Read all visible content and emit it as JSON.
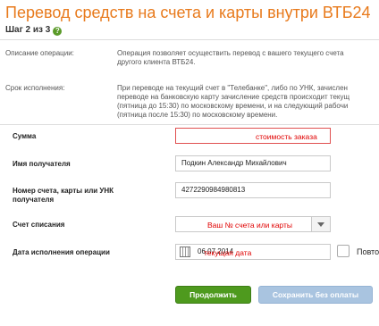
{
  "header": {
    "title": "Перевод средств на счета и карты внутри ВТБ24",
    "step": "Шаг 2 из 3",
    "help_icon": "?"
  },
  "info": {
    "description_label": "Описание операции:",
    "description_text": "Операция позволяет осуществить перевод с вашего текущего счета\nдругого клиента ВТБ24.",
    "timing_label": "Срок исполнения:",
    "timing_text": "При переводе на текущий счет в \"Телебанке\", либо по УНК, зачислен\nпереводе на банковскую карту зачисление средств происходит текущ\n(пятница до 15:30) по московскому времени, и на следующий рабочи\n(пятница после 15:30) по московскому времени."
  },
  "form": {
    "amount_label": "Сумма",
    "amount_value": "",
    "amount_note": "стоимость заказа",
    "recipient_label": "Имя получателя",
    "recipient_value": "Подкин Александр Михайлович",
    "account_label": "Номер счета, карты или УНК\nполучателя",
    "account_value": "4272290984980813",
    "debit_label": "Счет списания",
    "debit_note": "Ваш № счета  или  карты",
    "date_label": "Дата исполнения операции",
    "date_value": "06.07.2014",
    "date_note": "текущая дата",
    "repeat_label": "Повто"
  },
  "buttons": {
    "continue": "Продолжить",
    "save_unpaid": "Сохранить без оплаты"
  },
  "colors": {
    "title": "#e87a1c",
    "primary_button": "#4e9a1e",
    "secondary_button": "#a9c4e0",
    "note_red": "#e00000"
  }
}
